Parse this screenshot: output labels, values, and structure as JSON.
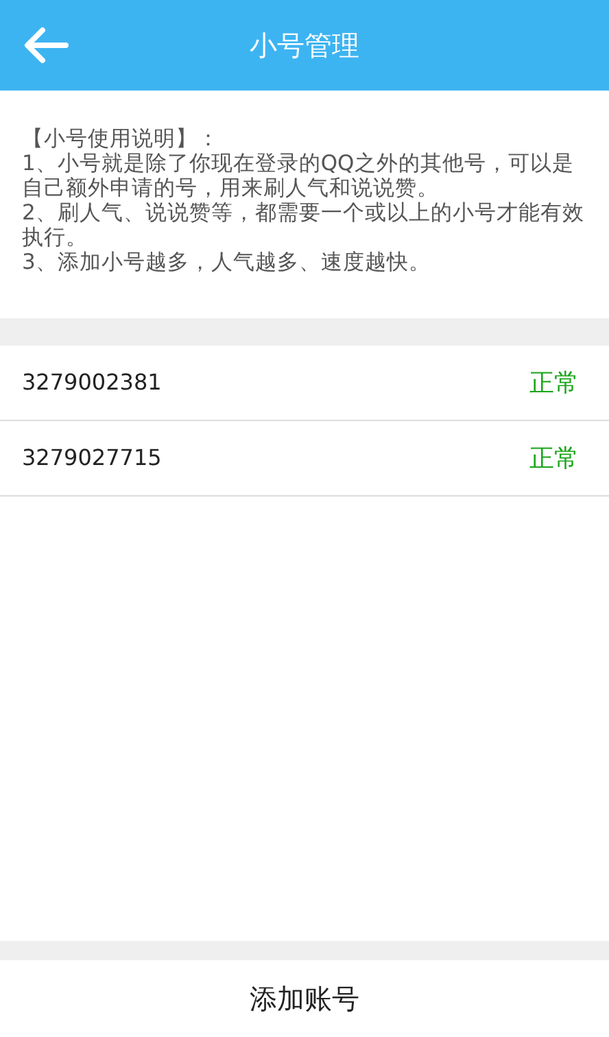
{
  "header": {
    "title": "小号管理"
  },
  "instructions": [
    "【小号使用说明】：",
    "1、小号就是除了你现在登录的QQ之外的其他号，可以是自己额外申请的号，用来刷人气和说说赞。",
    "2、刷人气、说说赞等，都需要一个或以上的小号才能有效执行。",
    "3、添加小号越多，人气越多、速度越快。"
  ],
  "accounts": [
    {
      "number": "3279002381",
      "status": "正常"
    },
    {
      "number": "3279027715",
      "status": "正常"
    }
  ],
  "add_button": "添加账号"
}
